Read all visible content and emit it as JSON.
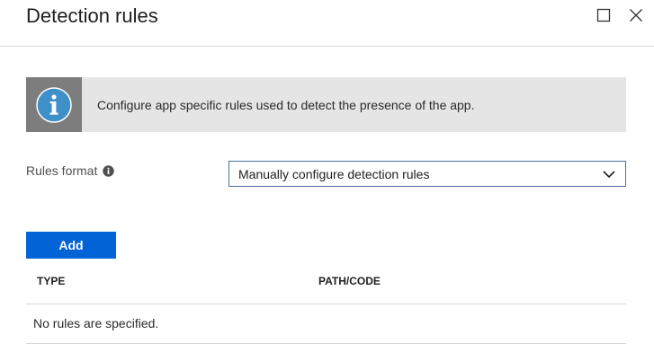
{
  "header": {
    "title": "Detection rules",
    "maximize_icon": "maximize-icon",
    "close_icon": "close-icon"
  },
  "info": {
    "icon": "info-icon",
    "text": "Configure app specific rules used to detect the presence of the app."
  },
  "rules_format": {
    "label": "Rules format",
    "info_icon": "info-circle-icon",
    "selected": "Manually configure detection rules"
  },
  "add_button": {
    "label": "Add"
  },
  "table": {
    "columns": [
      "TYPE",
      "PATH/CODE"
    ],
    "empty_message": "No rules are specified."
  },
  "colors": {
    "accent": "#0063d6",
    "info_bar_bg": "#e5e5e5",
    "info_icon_bg": "#7d7d7d",
    "info_circle": "#3f8fc9"
  }
}
